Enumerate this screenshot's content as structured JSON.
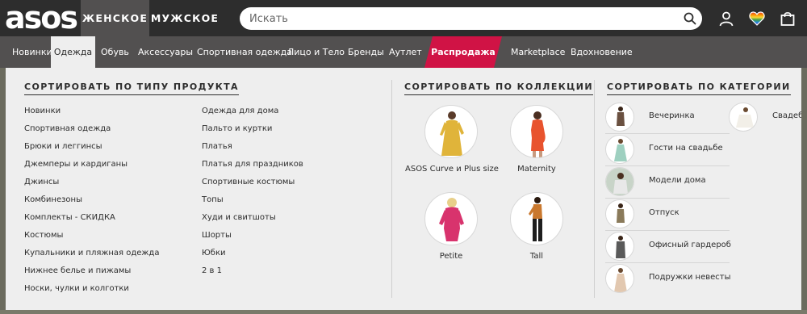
{
  "brand": {
    "logo": "asos"
  },
  "header": {
    "women_label": "ЖЕНСКОЕ",
    "men_label": "МУЖСКОЕ",
    "search_placeholder": "Искать",
    "icons": [
      "search-icon",
      "account-icon",
      "saved-items-icon",
      "bag-icon"
    ]
  },
  "nav": {
    "items": [
      "Новинки",
      "Одежда",
      "Обувь",
      "Аксессуары",
      "Спортивная одежда",
      "Лицо и Тело",
      "Бренды",
      "Аутлет",
      "Распродажа",
      "Marketplace",
      "Вдохновение"
    ],
    "active": "Одежда",
    "sale_color": "#d01345"
  },
  "menu": {
    "product_type": {
      "heading": "СОРТИРОВАТЬ ПО ТИПУ ПРОДУКТА",
      "col1": [
        "Новинки",
        "Спортивная одежда",
        "Брюки и леггинсы",
        "Джемперы и кардиганы",
        "Джинсы",
        "Комбинезоны",
        "Комплекты - СКИДКА",
        "Костюмы",
        "Купальники и пляжная одежда",
        "Нижнее белье и пижамы",
        "Носки, чулки и колготки"
      ],
      "col2": [
        "Одежда для дома",
        "Пальто и куртки",
        "Платья",
        "Платья для праздников",
        "Спортивные костюмы",
        "Топы",
        "Худи и свитшоты",
        "Шорты",
        "Юбки",
        "2 в 1"
      ]
    },
    "collection": {
      "heading": "СОРТИРОВАТЬ ПО КОЛЛЕКЦИИ",
      "items": [
        "ASOS Curve и Plus size",
        "Maternity",
        "Petite",
        "Tall"
      ]
    },
    "category": {
      "heading": "СОРТИРОВАТЬ ПО КАТЕГОРИИ",
      "items": [
        "Вечеринка",
        "Гости на свадьбе",
        "Модели дома",
        "Отпуск",
        "Офисный гардероб",
        "Подружки невесты"
      ],
      "extra": "Свадебн"
    }
  }
}
